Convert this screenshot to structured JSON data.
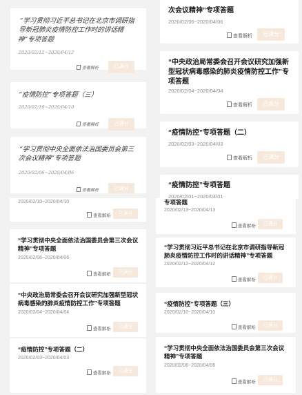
{
  "analysis_label": "查看解析",
  "button_label": "已满分",
  "panel1": {
    "items": [
      {
        "title": "“学习贯彻习近平总书记在北京市调研指导新冠肺炎疫情防控工作时的讲话精神”专项答题",
        "date": "2020/02/12~2020/04/12"
      },
      {
        "title": "“疫情防控”专项答题（三）",
        "date": "2020/02/10~2020/04/10"
      },
      {
        "title": "“学习贯彻中央全面依法治国委员会第三次会议精神”专项答题",
        "date": "2020/02/06~2020/04/06"
      }
    ]
  },
  "panel2": {
    "items": [
      {
        "title": "次会议精神”专项答题",
        "date": "2020/02/06~2020/04/06"
      },
      {
        "title": "“中央政治局常委会召开会议研究加强新型冠状病毒感染的肺炎疫情防控工作”专项答题",
        "date": "2020/02/04~2020/04/04"
      },
      {
        "title": "“疫情防控”专项答题（二）",
        "date": "2020/02/03~2020/04/03"
      },
      {
        "title": "“疫情防控”专项答题",
        "date": "2020/02/01~2020/04/01"
      }
    ]
  },
  "panel3": {
    "items": [
      {
        "title": "",
        "date": "2020/02/10~2020/04/10"
      },
      {
        "title": "“学习贯彻中央全面依法治国委员会第三次会议精神”专项答题",
        "date": "2020/02/06~2020/04/06"
      },
      {
        "title": "“中央政治局常委会召开会议研究加强新型冠状病毒感染的肺炎疫情防控工作”专项答题",
        "date": "2020/02/04~2020/04/04"
      },
      {
        "title": "“疫情防控”专项答题（二）",
        "date": "2020/02/03~2020/04/03"
      }
    ]
  },
  "panel4": {
    "items": [
      {
        "title": "专项答题",
        "date": "2020/02/13~2020/04/13"
      },
      {
        "title": "“学习贯彻习近平总书记在北京市调研指导新冠肺炎疫情防控工作时的讲话精神”专项答题",
        "date": "2020/02/12~2020/04/12"
      },
      {
        "title": "“疫情防控”专项答题（三）",
        "date": "2020/02/10~2020/04/10"
      },
      {
        "title": "“学习贯彻中央全面依法治国委员会第三次会议精神”专项答题",
        "date": "2020/02/06~2020/04/06"
      }
    ]
  }
}
